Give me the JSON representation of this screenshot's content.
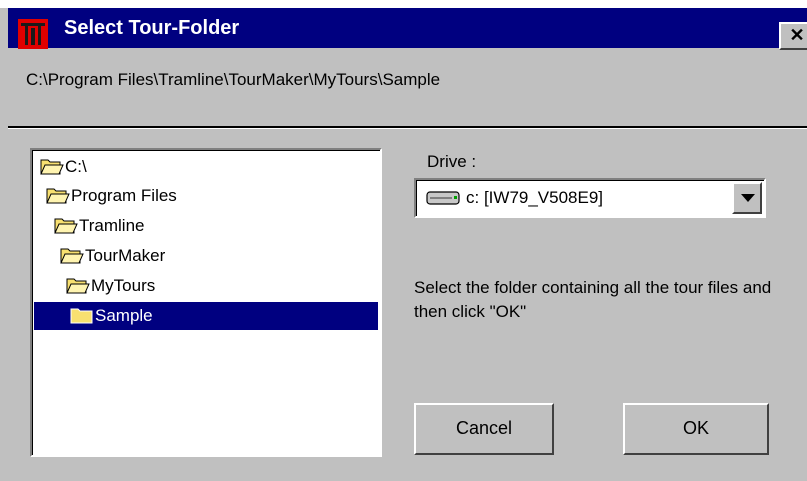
{
  "window": {
    "title": "Select Tour-Folder",
    "close_label": "✕",
    "app_icon": "tourmaker-app-icon"
  },
  "current_path": "C:\\Program Files\\Tramline\\TourMaker\\MyTours\\Sample",
  "tree": {
    "items": [
      {
        "label": "C:\\",
        "icon": "open-folder-icon",
        "selected": false
      },
      {
        "label": "Program Files",
        "icon": "open-folder-icon",
        "selected": false
      },
      {
        "label": "Tramline",
        "icon": "open-folder-icon",
        "selected": false
      },
      {
        "label": "TourMaker",
        "icon": "open-folder-icon",
        "selected": false
      },
      {
        "label": "MyTours",
        "icon": "open-folder-icon",
        "selected": false
      },
      {
        "label": "Sample",
        "icon": "closed-folder-icon",
        "selected": true
      }
    ]
  },
  "drive": {
    "label": "Drive :",
    "value": "c: [IW79_V508E9]",
    "icon": "hard-drive-icon"
  },
  "instruction": "Select the folder containing all the tour files and then click \"OK\"",
  "buttons": {
    "cancel": "Cancel",
    "ok": "OK"
  },
  "colors": {
    "titlebar": "#000080",
    "face": "#c0c0c0",
    "selection": "#000080",
    "app_icon": "#e00000",
    "folder": "#f8e070"
  }
}
